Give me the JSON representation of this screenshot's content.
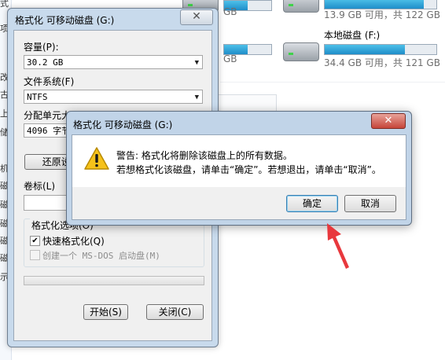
{
  "explorer": {
    "left_strip_chars": [
      "式",
      "项",
      "改",
      "古",
      "上",
      "储",
      "机",
      "磁",
      "磁",
      "磁",
      "磁",
      "磁",
      "示"
    ],
    "drives": [
      {
        "name": "",
        "info": "GB",
        "fill": 0.5
      },
      {
        "name": "",
        "info": "13.9 GB 可用，共 122 GB",
        "fill": 0.89
      },
      {
        "name": "",
        "info": "GB",
        "fill": 0.5
      },
      {
        "name": "本地磁盘 (F:)",
        "info": "34.4 GB 可用，共 121 GB",
        "fill": 0.72
      }
    ]
  },
  "format_window": {
    "title": "格式化 可移动磁盘 (G:)",
    "close_glyph": "✕",
    "capacity_label": "容量(P):",
    "capacity_value": "30.2 GB",
    "filesystem_label": "文件系统(F)",
    "filesystem_value": "NTFS",
    "alloc_label": "分配单元大小(A)",
    "alloc_value": "4096 字节",
    "restore_button": "还原设备的默认值(D)",
    "volume_label": "卷标(L)",
    "volume_value": "",
    "options_label": "格式化选项(O)",
    "quick_format": "快速格式化(Q)",
    "quick_format_checked": true,
    "msdos": "创建一个 MS-DOS 启动盘(M)",
    "msdos_checked": false,
    "progress": 0,
    "start_button": "开始(S)",
    "close_button": "关闭(C)"
  },
  "warning_dialog": {
    "title": "格式化 可移动磁盘 (G:)",
    "close_glyph": "✕",
    "icon": "warning-icon",
    "line1": "警告: 格式化将删除该磁盘上的所有数据。",
    "line2": "若想格式化该磁盘，请单击“确定”。若想退出，请单击“取消”。",
    "ok_button": "确定",
    "cancel_button": "取消"
  },
  "colors": {
    "annotation_arrow": "#e8383d",
    "window_frame": "#c8daec",
    "drive_bar": "#26a0da"
  }
}
